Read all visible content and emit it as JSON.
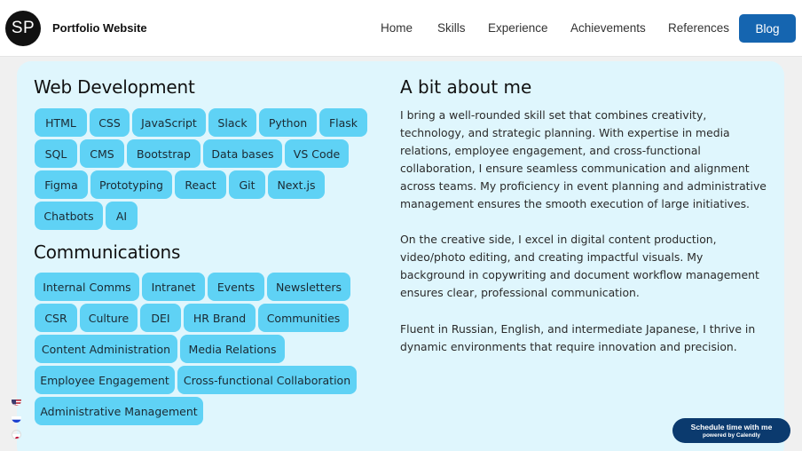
{
  "header": {
    "logo_initials": "SP",
    "site_title": "Portfolio Website",
    "nav": [
      "Home",
      "Skills",
      "Experience",
      "Achievements",
      "References"
    ],
    "blog_label": "Blog",
    "blog_color": "#1565b0"
  },
  "skills": {
    "web_title": "Web Development",
    "web_tags": [
      "HTML",
      "CSS",
      "JavaScript",
      "Slack",
      "Python",
      "Flask",
      "SQL",
      "CMS",
      "Bootstrap",
      "Data bases",
      "VS Code",
      "Figma",
      "Prototyping",
      "React",
      "Git",
      "Next.js",
      "Chatbots",
      "AI"
    ],
    "comms_title": "Communications",
    "comms_tags": [
      "Internal Comms",
      "Intranet",
      "Events",
      "Newsletters",
      "CSR",
      "Culture",
      "DEI",
      "HR Brand",
      "Communities",
      "Content Administration",
      "Media Relations",
      "Employee Engagement",
      "Cross-functional Collaboration",
      "Administrative Management"
    ],
    "tag_color": "#5fd2f5",
    "card_color": "#dff6fd"
  },
  "about": {
    "title": "A bit about me",
    "paragraphs": [
      "I bring a well-rounded skill set that combines creativity, technology, and strategic planning. With expertise in media relations, employee engagement, and cross-functional collaboration, I ensure seamless communication and alignment across teams. My proficiency in event planning and administrative management ensures the smooth execution of large initiatives.",
      "On the creative side, I excel in digital content production, video/photo editing, and creating impactful visuals. My background in copywriting and document workflow management ensures clear, professional communication.",
      "Fluent in Russian, English, and intermediate Japanese, I thrive in dynamic environments that require innovation and precision."
    ]
  },
  "languages": [
    {
      "icon": "us-flag-icon"
    },
    {
      "icon": "russia-flag-icon"
    },
    {
      "icon": "japan-flag-icon"
    }
  ],
  "calendly": {
    "label": "Schedule time with me",
    "sublabel": "powered by Calendly"
  }
}
